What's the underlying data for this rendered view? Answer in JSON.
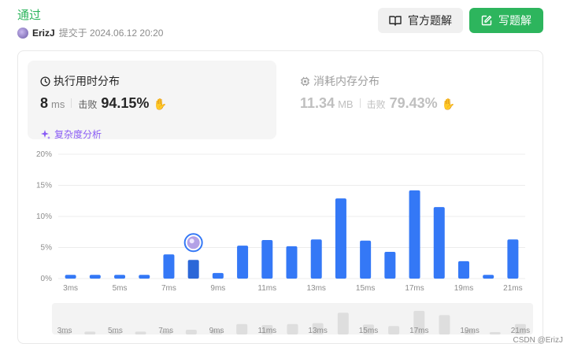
{
  "header": {
    "status": "通过",
    "user": "ErizJ",
    "submitted_label": "提交于 2024.06.12 20:20"
  },
  "buttons": {
    "official": "官方题解",
    "write": "写题解"
  },
  "runtime": {
    "title": "执行用时分布",
    "value": "8",
    "unit": "ms",
    "beats_label": "击败",
    "beats": "94.15%",
    "complexity_label": "复杂度分析"
  },
  "memory": {
    "title": "消耗内存分布",
    "value": "11.34",
    "unit": "MB",
    "beats_label": "击败",
    "beats": "79.43%"
  },
  "chart_data": {
    "type": "bar",
    "x_tick_labels": [
      "3ms",
      "5ms",
      "7ms",
      "9ms",
      "11ms",
      "13ms",
      "15ms",
      "17ms",
      "19ms",
      "21ms"
    ],
    "y_tick_labels": [
      "20%",
      "15%",
      "10%",
      "5%",
      "0%"
    ],
    "ylim": [
      0,
      20
    ],
    "x_start": 3,
    "x_end": 21,
    "x": [
      3,
      4,
      5,
      6,
      7,
      8,
      9,
      10,
      11,
      12,
      13,
      14,
      15,
      16,
      17,
      18,
      19,
      20,
      21
    ],
    "values": [
      0.6,
      0.6,
      0.6,
      0.6,
      3.9,
      3.0,
      0.9,
      5.3,
      6.2,
      5.2,
      6.3,
      12.9,
      6.1,
      4.3,
      14.2,
      11.5,
      2.8,
      0.6,
      6.3
    ],
    "highlight_x": 8,
    "bar_color": "#3478f6",
    "highlight_color": "#2b67d8",
    "grid": true,
    "mini_values": [
      0.6,
      0.6,
      0.6,
      0.6,
      0.8,
      1.0,
      0.9,
      2.2,
      2.0,
      2.2,
      2.4,
      4.6,
      2.1,
      1.8,
      5.0,
      4.1,
      1.0,
      0.5,
      2.2
    ],
    "mini_tick_labels": [
      "3ms",
      "5ms",
      "7ms",
      "9ms",
      "11ms",
      "13ms",
      "15ms",
      "17ms",
      "19ms",
      "21ms"
    ]
  },
  "watermark": "CSDN @ErizJ",
  "colors": {
    "accent_green": "#2db55d",
    "bar_blue": "#3478f6",
    "complexity_purple": "#8a5cf5"
  },
  "icons": {
    "official": "book-icon",
    "write": "edit-icon",
    "runtime": "clock-icon",
    "memory": "chip-icon",
    "complexity": "sparkle-icon",
    "beats": "clap-icon"
  }
}
